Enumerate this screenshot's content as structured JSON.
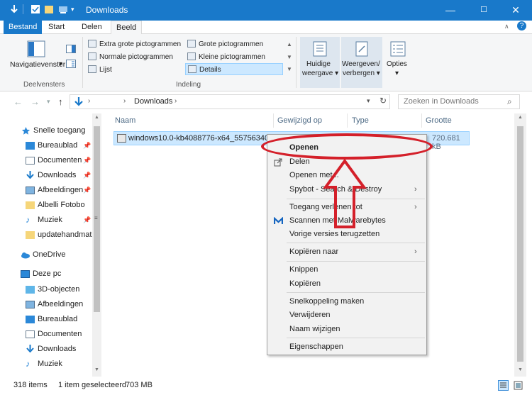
{
  "window": {
    "title": "Downloads",
    "minimize": "—",
    "maximize": "☐",
    "close": "✕"
  },
  "ribbon_tabs": {
    "file": "Bestand",
    "start": "Start",
    "share": "Delen",
    "view": "Beeld"
  },
  "ribbon": {
    "nav_pane_label": "Navigatievenster",
    "group_panes": "Deelvensters",
    "group_layout": "Indeling",
    "layout_items": {
      "extra_large": "Extra grote pictogrammen",
      "large": "Grote pictogrammen",
      "normal": "Normale pictogrammen",
      "small": "Kleine pictogrammen",
      "list": "Lijst",
      "details": "Details"
    },
    "current_view": [
      "Huidige",
      "weergave"
    ],
    "show_hide": [
      "Weergeven/",
      "verbergen"
    ],
    "options": "Opties"
  },
  "address": {
    "path": "Downloads",
    "search_placeholder": "Zoeken in Downloads"
  },
  "nav": {
    "quick_access": "Snelle toegang",
    "quick_items": [
      "Bureaublad",
      "Documenten",
      "Downloads",
      "Afbeeldingen",
      "Albelli Fotobo",
      "Muziek",
      "updatehandmat"
    ],
    "onedrive": "OneDrive",
    "this_pc": "Deze pc",
    "pc_items": [
      "3D-objecten",
      "Afbeeldingen",
      "Bureaublad",
      "Documenten",
      "Downloads",
      "Muziek"
    ]
  },
  "columns": {
    "name": "Naam",
    "modified": "Gewijzigd op",
    "type": "Type",
    "size": "Grootte"
  },
  "file": {
    "name": "windows10.0-kb4088776-x64_55756340f1...",
    "size": "720.681 kB"
  },
  "context_menu": {
    "open": "Openen",
    "share": "Delen",
    "open_with": "Openen met...",
    "spybot": "Spybot - Search & Destroy",
    "give_access": "Toegang verlenen tot",
    "malwarebytes": "Scannen met Malwarebytes",
    "restore": "Vorige versies terugzetten",
    "copy_to": "Kopiëren naar",
    "cut": "Knippen",
    "copy": "Kopiëren",
    "shortcut": "Snelkoppeling maken",
    "delete": "Verwijderen",
    "rename": "Naam wijzigen",
    "properties": "Eigenschappen"
  },
  "status": {
    "items": "318 items",
    "selected": "1 item geselecteerd",
    "sel_size": "703 MB"
  },
  "colors": {
    "accent": "#1979ca",
    "annotation": "#d4202a",
    "selection": "#cce8ff"
  }
}
